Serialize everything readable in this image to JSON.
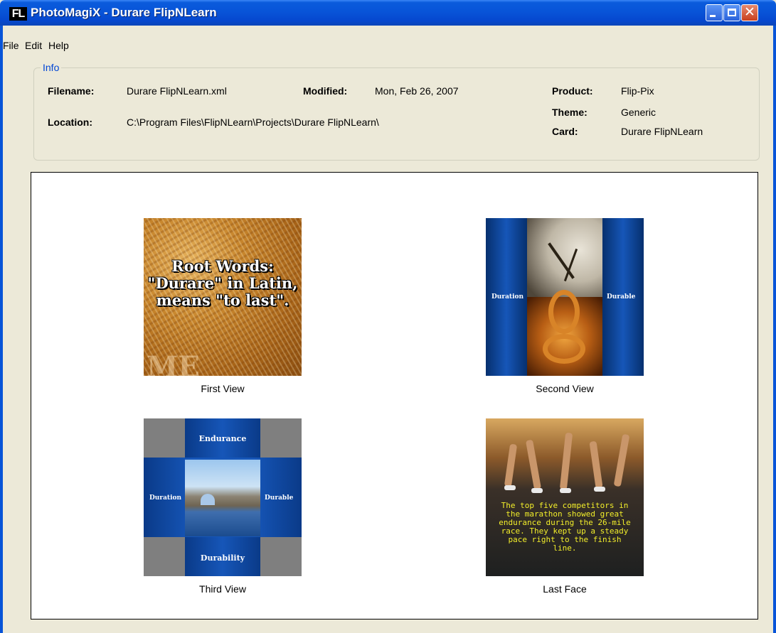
{
  "window": {
    "title": "PhotoMagiX - Durare FlipNLearn",
    "icon_label": "FL",
    "controls": [
      "minimize",
      "maximize",
      "close"
    ]
  },
  "menu": [
    "File",
    "Edit",
    "Help"
  ],
  "info": {
    "group_title": "Info",
    "filename_label": "Filename:",
    "filename": "Durare FlipNLearn.xml",
    "modified_label": "Modified:",
    "modified": "Mon, Feb 26, 2007",
    "location_label": "Location:",
    "location": "C:\\Program Files\\FlipNLearn\\Projects\\Durare FlipNLearn\\",
    "product_label": "Product:",
    "product": "Flip-Pix",
    "theme_label": "Theme:",
    "theme": "Generic",
    "card_label": "Card:",
    "card": "Durare FlipNLearn"
  },
  "views": [
    {
      "caption": "First View",
      "text": "Root Words: \"Durare\" in Latin, means \"to last\".",
      "background_text": "ME"
    },
    {
      "caption": "Second View",
      "left_label": "Duration",
      "right_label": "Durable"
    },
    {
      "caption": "Third View",
      "top_label": "Endurance",
      "bottom_label": "Durability",
      "left_label": "Duration",
      "right_label": "Durable"
    },
    {
      "caption": "Last Face",
      "text": "The top five competitors in the marathon showed great endurance during the 26-mile race. They kept up a steady pace right to the finish line."
    }
  ],
  "colors": {
    "titlebar": "#0854D8",
    "window_bg": "#ECE9D8",
    "group_title": "#0046D5",
    "card_blue": "#1656B8",
    "last_face_text": "#F2EE2A"
  }
}
